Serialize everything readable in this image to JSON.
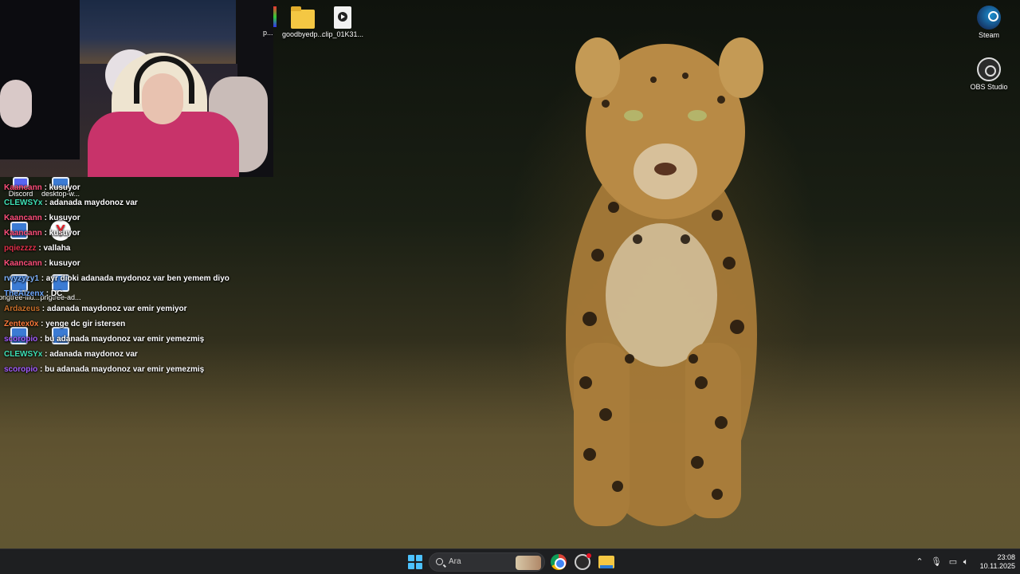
{
  "desktop_icons": {
    "top": [
      {
        "label": "p...",
        "icon": "app-shortcut-icon"
      },
      {
        "label": "goodbyedp...",
        "icon": "folder-icon"
      },
      {
        "label": "clip_01K31...",
        "icon": "video-file-icon"
      }
    ],
    "right": [
      {
        "label": "Steam",
        "icon": "steam-icon"
      },
      {
        "label": "OBS Studio",
        "icon": "obs-studio-icon"
      }
    ],
    "left": [
      {
        "label": "Discord",
        "icon": "discord-icon"
      },
      {
        "label": "desktop-w...",
        "icon": "image-file-icon"
      },
      {
        "label": "pngtree-illu...",
        "icon": "image-file-icon"
      },
      {
        "label": "pngtree-ad...",
        "icon": "image-file-icon"
      }
    ]
  },
  "chat": {
    "messages": [
      {
        "user": "Kaancann",
        "color": "#ff4f7b",
        "text": " : kusuyor"
      },
      {
        "user": "CLEWSYx",
        "color": "#3ee0b5",
        "text": " : adanada maydonoz var"
      },
      {
        "user": "Kaancann",
        "color": "#ff4f7b",
        "text": " : kusuyor"
      },
      {
        "user": "Kaancann",
        "color": "#ff4f7b",
        "text": " : kusuyor"
      },
      {
        "user": "pqiezzzz",
        "color": "#e0304a",
        "text": " : vallaha"
      },
      {
        "user": "Kaancann",
        "color": "#ff4f7b",
        "text": " : kusuyor"
      },
      {
        "user": "rwyzyzy1",
        "color": "#7fb4ff",
        "text": " : ayr dioki adanada mydonoz var ben yemem diyo"
      },
      {
        "user": "TheAizenx",
        "color": "#6ea8ff",
        "text": " : DC"
      },
      {
        "user": "Ardazeus",
        "color": "#c8702a",
        "text": " : adanada maydonoz var emir yemiyor"
      },
      {
        "user": "Zentex0x",
        "color": "#ff7a3a",
        "text": " : yenge dc gir istersen"
      },
      {
        "user": "scoropio",
        "color": "#a35cff",
        "text": " : bu adanada maydonoz var emir yemezmiş"
      },
      {
        "user": "CLEWSYx",
        "color": "#3ee0b5",
        "text": " : adanada maydonoz var"
      },
      {
        "user": "scoropio",
        "color": "#a35cff",
        "text": " : bu adanada maydonoz var emir yemezmiş"
      }
    ]
  },
  "taskbar": {
    "search_placeholder": "Ara",
    "apps": [
      "chrome-icon",
      "obs-studio-icon",
      "file-explorer-icon"
    ],
    "time": "23:08",
    "date": "10.11.2025"
  },
  "colors": {
    "taskbar_bg": "#1e1f21",
    "accent": "#4cc2ff"
  }
}
